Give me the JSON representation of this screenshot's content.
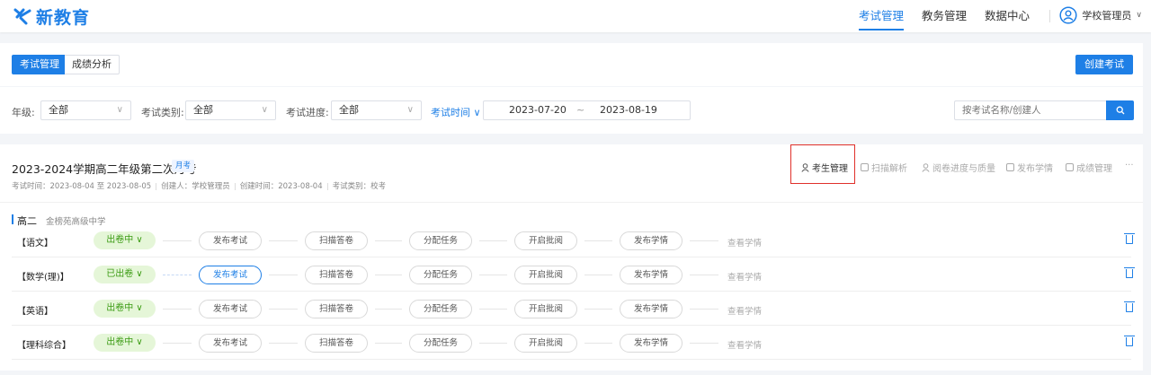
{
  "header": {
    "logo_text": "新教育",
    "nav": [
      {
        "label": "考试管理",
        "active": true
      },
      {
        "label": "教务管理",
        "active": false
      },
      {
        "label": "数据中心",
        "active": false
      }
    ],
    "user_label": "学校管理员",
    "accent_color": "#1e7fe6"
  },
  "tabs": [
    {
      "label": "考试管理",
      "active": true
    },
    {
      "label": "成绩分析",
      "active": false
    }
  ],
  "create_label": "创建考试",
  "filters": {
    "grade_label": "年级:",
    "grade_value": "全部",
    "type_label": "考试类别:",
    "type_value": "全部",
    "progress_label": "考试进度:",
    "progress_value": "全部",
    "time_label": "考试时间 ∨",
    "date_start": "2023-07-20",
    "date_sep": "~",
    "date_end": "2023-08-19",
    "search_placeholder": "按考试名称/创建人"
  },
  "exam": {
    "title": "2023-2024学期高二年级第二次月考",
    "tag": "月考",
    "meta": {
      "time": "考试时间：2023-08-04 至 2023-08-05",
      "creator": "创建人：学校管理员",
      "created": "创建时间：2023-08-04",
      "category": "考试类别：校考"
    },
    "actions": [
      {
        "label": "考生管理",
        "icon": "person-icon"
      },
      {
        "label": "扫描解析",
        "icon": "printer-icon"
      },
      {
        "label": "阅卷进度与质量",
        "icon": "person-icon"
      },
      {
        "label": "发布学情",
        "icon": "doc-icon"
      },
      {
        "label": "成绩管理",
        "icon": "doc-icon"
      },
      {
        "label": "···",
        "icon": ""
      }
    ],
    "grade": "高二",
    "school": "金榜苑高级中学",
    "steps": [
      "发布考试",
      "扫描答卷",
      "分配任务",
      "开启批阅",
      "发布学情"
    ],
    "view_label": "查看学情",
    "subjects": [
      {
        "name": "【语文】",
        "status": "出卷中 ∨"
      },
      {
        "name": "【数学(理)】",
        "status": "已出卷 ∨"
      },
      {
        "name": "【英语】",
        "status": "出卷中 ∨"
      },
      {
        "name": "【理科综合】",
        "status": "出卷中 ∨"
      }
    ]
  }
}
